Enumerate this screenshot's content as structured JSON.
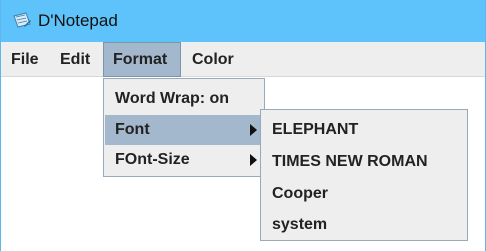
{
  "window": {
    "title": "D'Notepad",
    "icon": "notepad-icon"
  },
  "menubar": {
    "items": [
      {
        "label": "File"
      },
      {
        "label": "Edit"
      },
      {
        "label": "Format",
        "active": true
      },
      {
        "label": "Color"
      }
    ]
  },
  "format_menu": {
    "items": [
      {
        "label": "Word Wrap: on"
      },
      {
        "label": "Font",
        "selected": true,
        "submenu": true
      },
      {
        "label": "FOnt-Size",
        "submenu": true
      }
    ]
  },
  "font_submenu": {
    "items": [
      {
        "label": "ELEPHANT"
      },
      {
        "label": "TIMES NEW ROMAN"
      },
      {
        "label": "Cooper"
      },
      {
        "label": "system"
      }
    ]
  },
  "colors": {
    "titlebar": "#5ec3fa",
    "menu_background": "#eeeeee",
    "selection": "#a3b8cc"
  }
}
